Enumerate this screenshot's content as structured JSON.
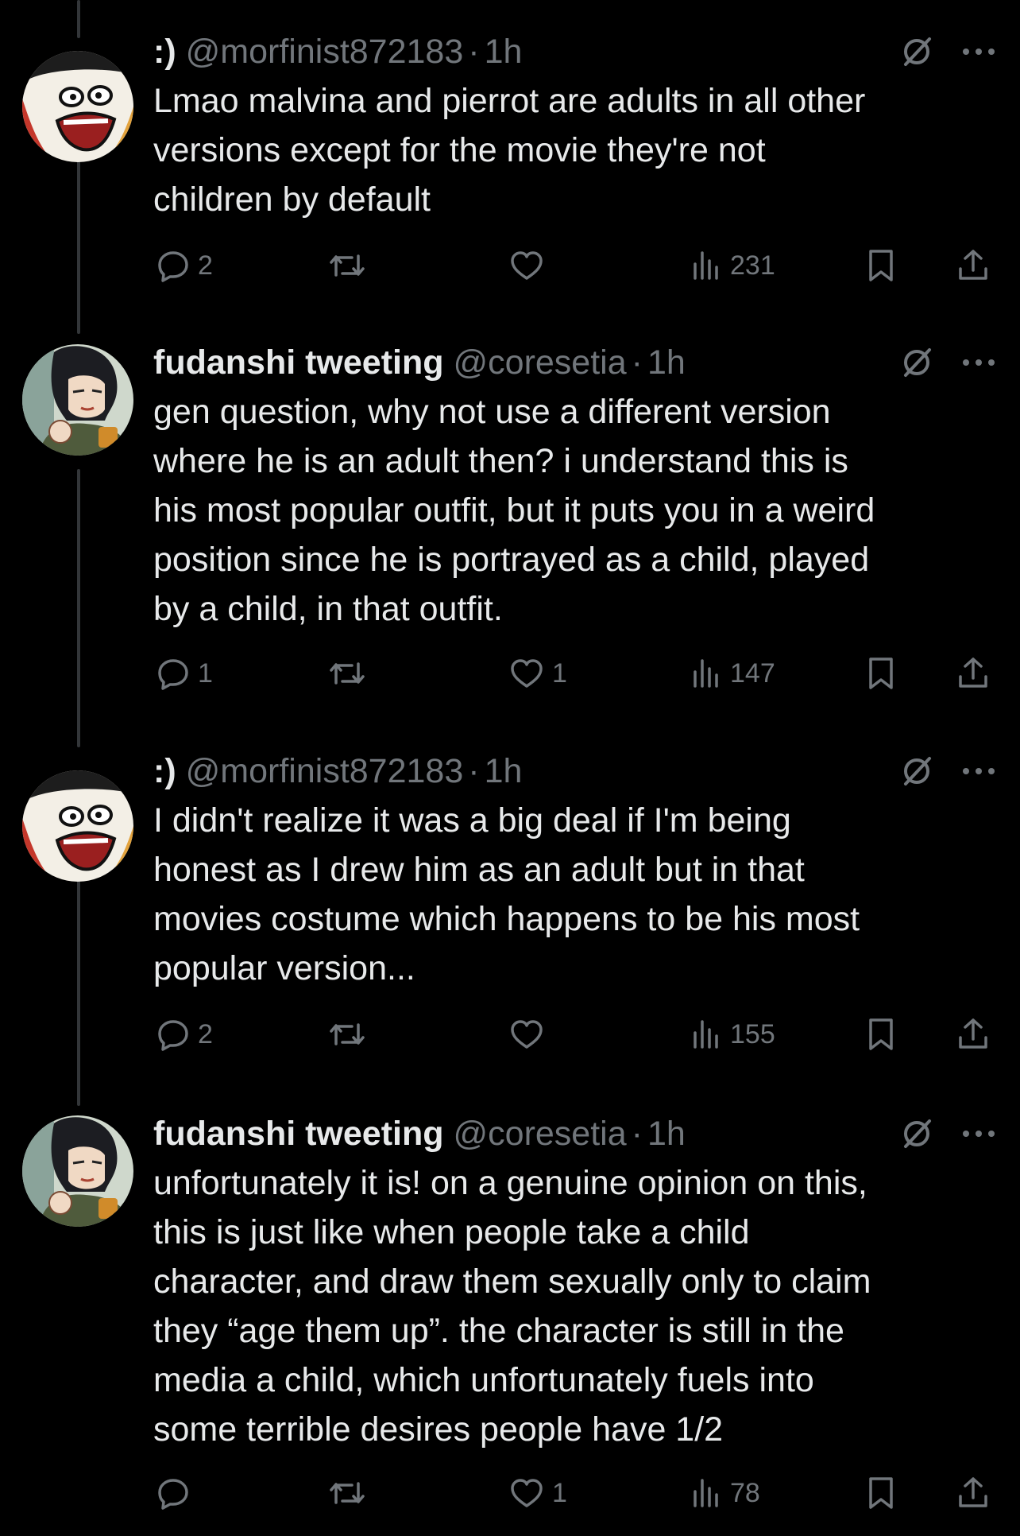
{
  "tweets": [
    {
      "display_name": ":)",
      "handle": "@morfinist872183",
      "separator": "·",
      "time": "1h",
      "text": "Lmao malvina and pierrot are adults in all other\nversions except for the movie they're not\nchildren by default",
      "counts": {
        "replies": "2",
        "reposts": "",
        "likes": "",
        "views": "231"
      },
      "avatar": "angry-cartoon-avatar"
    },
    {
      "display_name": "fudanshi tweeting",
      "handle": "@coresetia",
      "separator": "·",
      "time": "1h",
      "text": "gen question, why not use a different version\nwhere he is an adult then? i understand this is\nhis most popular outfit, but it puts you in a weird\nposition since he is portrayed as a child, played\nby a child, in that outfit.",
      "counts": {
        "replies": "1",
        "reposts": "",
        "likes": "1",
        "views": "147"
      },
      "avatar": "anime-character-avatar"
    },
    {
      "display_name": ":)",
      "handle": "@morfinist872183",
      "separator": "·",
      "time": "1h",
      "text": "I didn't realize it was a big deal if I'm being\nhonest as I drew him as an adult but in that\nmovies costume which happens to be his most\npopular version...",
      "counts": {
        "replies": "2",
        "reposts": "",
        "likes": "",
        "views": "155"
      },
      "avatar": "angry-cartoon-avatar"
    },
    {
      "display_name": "fudanshi tweeting",
      "handle": "@coresetia",
      "separator": "·",
      "time": "1h",
      "text": "unfortunately it is! on a genuine opinion on this,\nthis is just like when people take a child\ncharacter, and draw them sexually only to claim\nthey “age them up”. the character is still in the\nmedia a child, which unfortunately fuels into\nsome terrible desires people have 1/2",
      "counts": {
        "replies": "",
        "reposts": "",
        "likes": "1",
        "views": "78"
      },
      "avatar": "anime-character-avatar"
    }
  ],
  "colors": {
    "background": "#000000",
    "text_primary": "#e7e9ea",
    "text_secondary": "#71767b",
    "thread_line": "#333639"
  },
  "icons": [
    "grok-slash-icon",
    "more-icon",
    "reply-icon",
    "repost-icon",
    "like-icon",
    "views-icon",
    "bookmark-icon",
    "share-icon"
  ]
}
